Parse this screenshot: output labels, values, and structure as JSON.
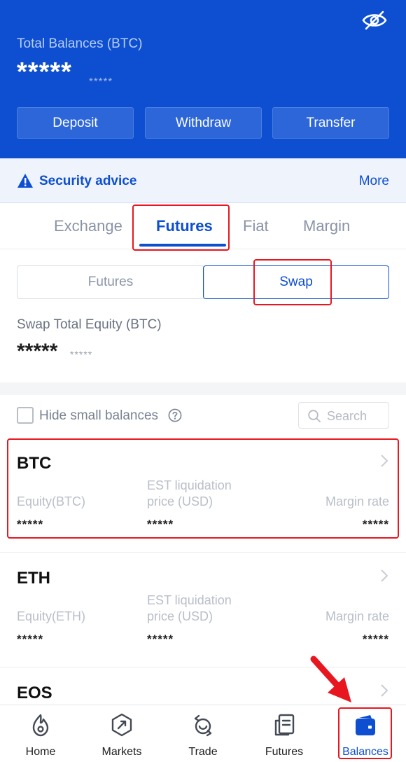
{
  "header": {
    "total_label": "Total Balances (BTC)",
    "total_value": "*****",
    "total_sub": "*****",
    "buttons": [
      "Deposit",
      "Withdraw",
      "Transfer"
    ]
  },
  "security": {
    "text": "Security advice",
    "more": "More"
  },
  "tabs": [
    "Exchange",
    "Futures",
    "Fiat",
    "Margin"
  ],
  "active_tab": "Futures",
  "segment": {
    "left": "Futures",
    "right": "Swap",
    "selected": "Swap"
  },
  "equity": {
    "label": "Swap Total Equity (BTC)",
    "value": "*****",
    "sub": "*****"
  },
  "filter": {
    "hide_small": "Hide small balances",
    "search_placeholder": "Search"
  },
  "assets": [
    {
      "name": "BTC",
      "equity_label": "Equity(BTC)",
      "liq_label_1": "EST liquidation",
      "liq_label_2": "price (USD)",
      "margin_label": "Margin rate",
      "equity_value": "*****",
      "liq_value": "*****",
      "margin_value": "*****"
    },
    {
      "name": "ETH",
      "equity_label": "Equity(ETH)",
      "liq_label_1": "EST liquidation",
      "liq_label_2": "price (USD)",
      "margin_label": "Margin rate",
      "equity_value": "*****",
      "liq_value": "*****",
      "margin_value": "*****"
    },
    {
      "name": "EOS"
    }
  ],
  "nav": {
    "items": [
      "Home",
      "Markets",
      "Trade",
      "Futures",
      "Balances"
    ],
    "active": "Balances"
  },
  "colors": {
    "brand_blue": "#0d4fd0",
    "highlight_red": "#e8171f"
  }
}
